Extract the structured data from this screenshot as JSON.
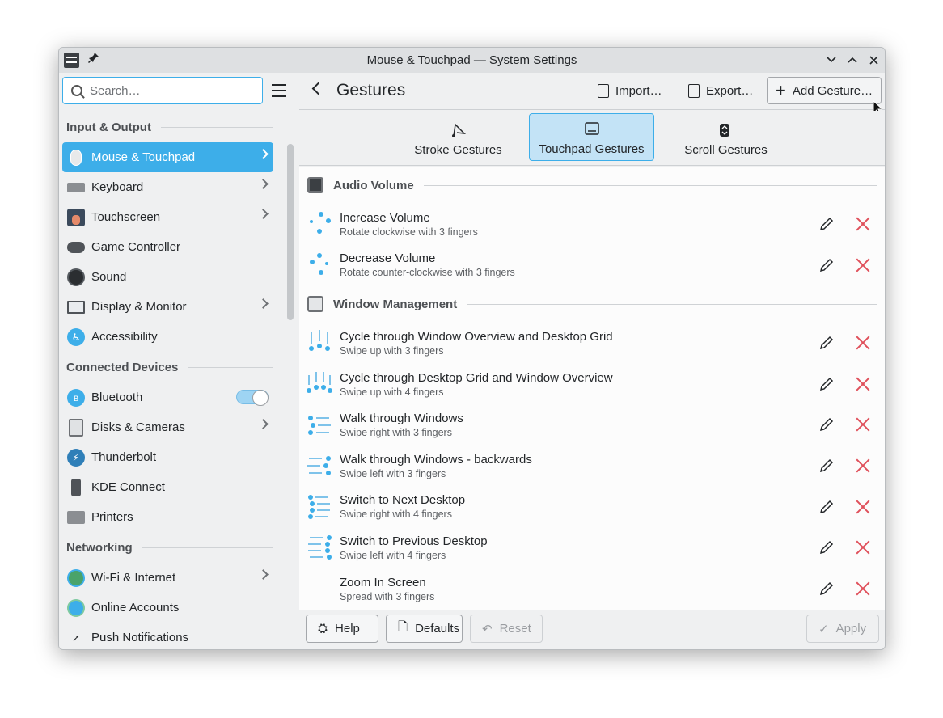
{
  "window": {
    "title": "Mouse & Touchpad — System Settings",
    "controls": [
      "minimize",
      "maximize",
      "close"
    ]
  },
  "sidebar": {
    "search_placeholder": "Search…",
    "sections": [
      {
        "header": "Input & Output",
        "items": [
          {
            "label": "Mouse & Touchpad",
            "icon": "mouse-icon",
            "active": true,
            "chevron": true
          },
          {
            "label": "Keyboard",
            "icon": "keyboard-icon",
            "chevron": true
          },
          {
            "label": "Touchscreen",
            "icon": "touchscreen-icon",
            "chevron": true
          },
          {
            "label": "Game Controller",
            "icon": "gamepad-icon"
          },
          {
            "label": "Sound",
            "icon": "speaker-icon"
          },
          {
            "label": "Display & Monitor",
            "icon": "monitor-icon",
            "chevron": true
          },
          {
            "label": "Accessibility",
            "icon": "accessibility-icon"
          }
        ]
      },
      {
        "header": "Connected Devices",
        "items": [
          {
            "label": "Bluetooth",
            "icon": "bluetooth-icon",
            "toggle": true
          },
          {
            "label": "Disks & Cameras",
            "icon": "disk-icon",
            "chevron": true
          },
          {
            "label": "Thunderbolt",
            "icon": "thunderbolt-icon"
          },
          {
            "label": "KDE Connect",
            "icon": "phone-icon"
          },
          {
            "label": "Printers",
            "icon": "printer-icon"
          }
        ]
      },
      {
        "header": "Networking",
        "items": [
          {
            "label": "Wi-Fi & Internet",
            "icon": "globe-icon",
            "chevron": true
          },
          {
            "label": "Online Accounts",
            "icon": "accounts-icon"
          },
          {
            "label": "Push Notifications",
            "icon": "push-icon"
          }
        ]
      }
    ]
  },
  "header": {
    "title": "Gestures",
    "import_label": "Import…",
    "export_label": "Export…",
    "add_label": "Add Gesture…"
  },
  "tabs": [
    {
      "label": "Stroke Gestures",
      "icon": "stroke-icon"
    },
    {
      "label": "Touchpad Gestures",
      "icon": "touchpad-icon",
      "active": true
    },
    {
      "label": "Scroll Gestures",
      "icon": "scroll-icon"
    }
  ],
  "groups": [
    {
      "label": "Audio Volume",
      "icon": "speaker-icon",
      "rows": [
        {
          "title": "Increase Volume",
          "subtitle": "Rotate clockwise with 3 fingers",
          "icon": "rotate-cw-icon"
        },
        {
          "title": "Decrease Volume",
          "subtitle": "Rotate counter-clockwise with 3 fingers",
          "icon": "rotate-ccw-icon"
        }
      ]
    },
    {
      "label": "Window Management",
      "icon": "window-icon",
      "rows": [
        {
          "title": "Cycle through Window Overview and Desktop Grid",
          "subtitle": "Swipe up with 3 fingers",
          "icon": "swipe-up-3-icon"
        },
        {
          "title": "Cycle through Desktop Grid and Window Overview",
          "subtitle": "Swipe up with 4 fingers",
          "icon": "swipe-up-4-icon"
        },
        {
          "title": "Walk through Windows",
          "subtitle": "Swipe right with 3 fingers",
          "icon": "swipe-right-3-icon"
        },
        {
          "title": "Walk through Windows - backwards",
          "subtitle": "Swipe left with 3 fingers",
          "icon": "swipe-left-3-icon"
        },
        {
          "title": "Switch to Next Desktop",
          "subtitle": "Swipe right with 4 fingers",
          "icon": "swipe-right-4-icon"
        },
        {
          "title": "Switch to Previous Desktop",
          "subtitle": "Swipe left with 4 fingers",
          "icon": "swipe-left-4-icon"
        },
        {
          "title": "Zoom In Screen",
          "subtitle": "Spread with 3 fingers",
          "icon": ""
        }
      ]
    }
  ],
  "footer": {
    "help_label": "Help",
    "defaults_label": "Defaults",
    "reset_label": "Reset",
    "apply_label": "Apply"
  },
  "colors": {
    "accent": "#3daee9",
    "accent_light": "#c3e3f6",
    "delete": "#e0505b"
  }
}
